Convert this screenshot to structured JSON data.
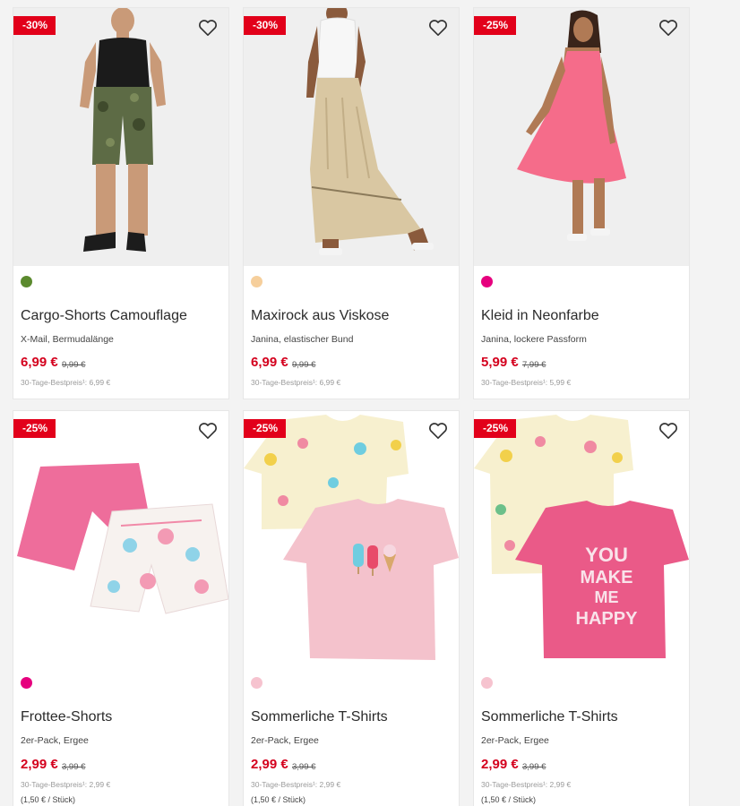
{
  "products": [
    {
      "discount": "-30%",
      "swatch_color": "#5b8a2e",
      "title": "Cargo-Shorts Camouflage",
      "subtitle": "X-Mail, Bermudalänge",
      "price": "6,99 €",
      "old_price": "9,99 €",
      "best_price_label": "30-Tage-Bestpreis¹: 6,99 €",
      "image_icon": "man-cargo-shorts-image"
    },
    {
      "discount": "-30%",
      "swatch_color": "#f6cf9c",
      "title": "Maxirock aus Viskose",
      "subtitle": "Janina, elastischer Bund",
      "price": "6,99 €",
      "old_price": "9,99 €",
      "best_price_label": "30-Tage-Bestpreis¹: 6,99 €",
      "image_icon": "woman-maxi-skirt-image"
    },
    {
      "discount": "-25%",
      "swatch_color": "#e6007e",
      "title": "Kleid in Neonfarbe",
      "subtitle": "Janina, lockere Passform",
      "price": "5,99 €",
      "old_price": "7,99 €",
      "best_price_label": "30-Tage-Bestpreis¹: 5,99 €",
      "image_icon": "woman-pink-dress-image"
    },
    {
      "discount": "-25%",
      "swatch_color": "#e6007e",
      "title": "Frottee-Shorts",
      "subtitle": "2er-Pack, Ergee",
      "price": "2,99 €",
      "old_price": "3,99 €",
      "best_price_label": "30-Tage-Bestpreis¹: 2,99 €",
      "unit_price": "(1,50 € / Stück)",
      "image_icon": "terry-shorts-image"
    },
    {
      "discount": "-25%",
      "swatch_color": "#f6c3cf",
      "title": "Sommerliche T-Shirts",
      "subtitle": "2er-Pack, Ergee",
      "price": "2,99 €",
      "old_price": "3,99 €",
      "best_price_label": "30-Tage-Bestpreis¹: 2,99 €",
      "unit_price": "(1,50 € / Stück)",
      "image_icon": "ice-cream-tshirts-image"
    },
    {
      "discount": "-25%",
      "swatch_color": "#f6c3cf",
      "title": "Sommerliche T-Shirts",
      "subtitle": "2er-Pack, Ergee",
      "price": "2,99 €",
      "old_price": "3,99 €",
      "best_price_label": "30-Tage-Bestpreis¹: 2,99 €",
      "unit_price": "(1,50 € / Stück)",
      "image_icon": "flamingo-tshirts-image",
      "shirt_print": [
        "YOU",
        "MAKE",
        "ME",
        "HAPPY"
      ]
    }
  ],
  "favorite_icon": "heart-outline-icon"
}
